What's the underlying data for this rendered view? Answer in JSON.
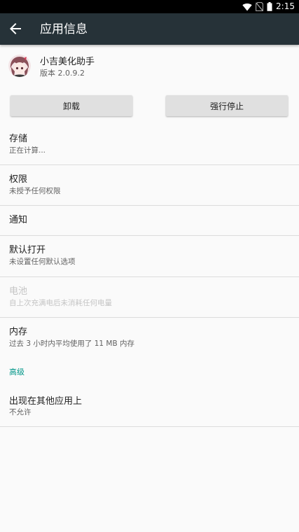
{
  "status_bar": {
    "time": "2:15",
    "icons": [
      "wifi-icon",
      "no-sim-icon",
      "battery-icon"
    ]
  },
  "toolbar": {
    "back_icon": "arrow-back-icon",
    "title": "应用信息"
  },
  "app": {
    "name": "小吉美化助手",
    "version": "版本 2.0.9.2"
  },
  "buttons": {
    "uninstall": "卸载",
    "force_stop": "强行停止"
  },
  "settings": {
    "storage": {
      "title": "存储",
      "summary": "正在计算..."
    },
    "permissions": {
      "title": "权限",
      "summary": "未授予任何权限"
    },
    "notifications": {
      "title": "通知"
    },
    "open_by_default": {
      "title": "默认打开",
      "summary": "未设置任何默认选项"
    },
    "battery": {
      "title": "电池",
      "summary": "自上次充满电后未消耗任何电量"
    },
    "memory": {
      "title": "内存",
      "summary": "过去 3 小时内平均使用了 11 MB 内存"
    },
    "advanced_header": "高级",
    "draw_over": {
      "title": "出现在其他应用上",
      "summary": "不允许"
    }
  },
  "colors": {
    "toolbar": "#263238",
    "accent": "#009688",
    "background": "#fafafa",
    "button": "#e0e0e0"
  }
}
